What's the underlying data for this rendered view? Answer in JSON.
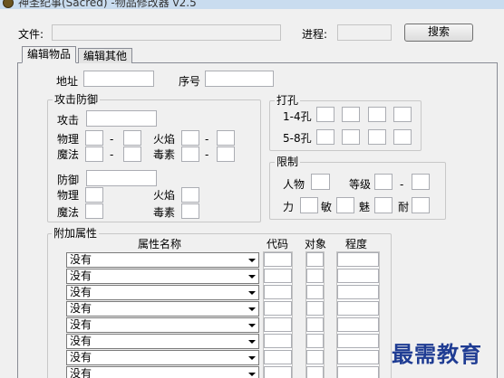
{
  "window": {
    "title": "神圣纪事(Sacred) -物品修改器 v2.5"
  },
  "top": {
    "file_label": "文件:",
    "progress_label": "进程:",
    "search_button": "搜索"
  },
  "tabs": [
    "编辑物品",
    "编辑其他"
  ],
  "item": {
    "address_label": "地址",
    "serial_label": "序号"
  },
  "attack_defense": {
    "title": "攻击防御",
    "attack_label": "攻击",
    "physical_label": "物理",
    "fire_label": "火焰",
    "magic_label": "魔法",
    "poison_label": "毒素",
    "dash": "-",
    "defense_label": "防御"
  },
  "sockets": {
    "title": "打孔",
    "row1_label": "1-4孔",
    "row2_label": "5-8孔"
  },
  "limits": {
    "title": "限制",
    "person_label": "人物",
    "level_label": "等级",
    "dash": "-",
    "str_label": "力",
    "agi_label": "敏",
    "cha_label": "魅",
    "end_label": "耐"
  },
  "attributes": {
    "title": "附加属性",
    "columns": [
      "属性名称",
      "代码",
      "对象",
      "程度"
    ],
    "rows": [
      "没有",
      "没有",
      "没有",
      "没有",
      "没有",
      "没有",
      "没有",
      "没有"
    ]
  },
  "watermark": {
    "text": "最需教育"
  }
}
